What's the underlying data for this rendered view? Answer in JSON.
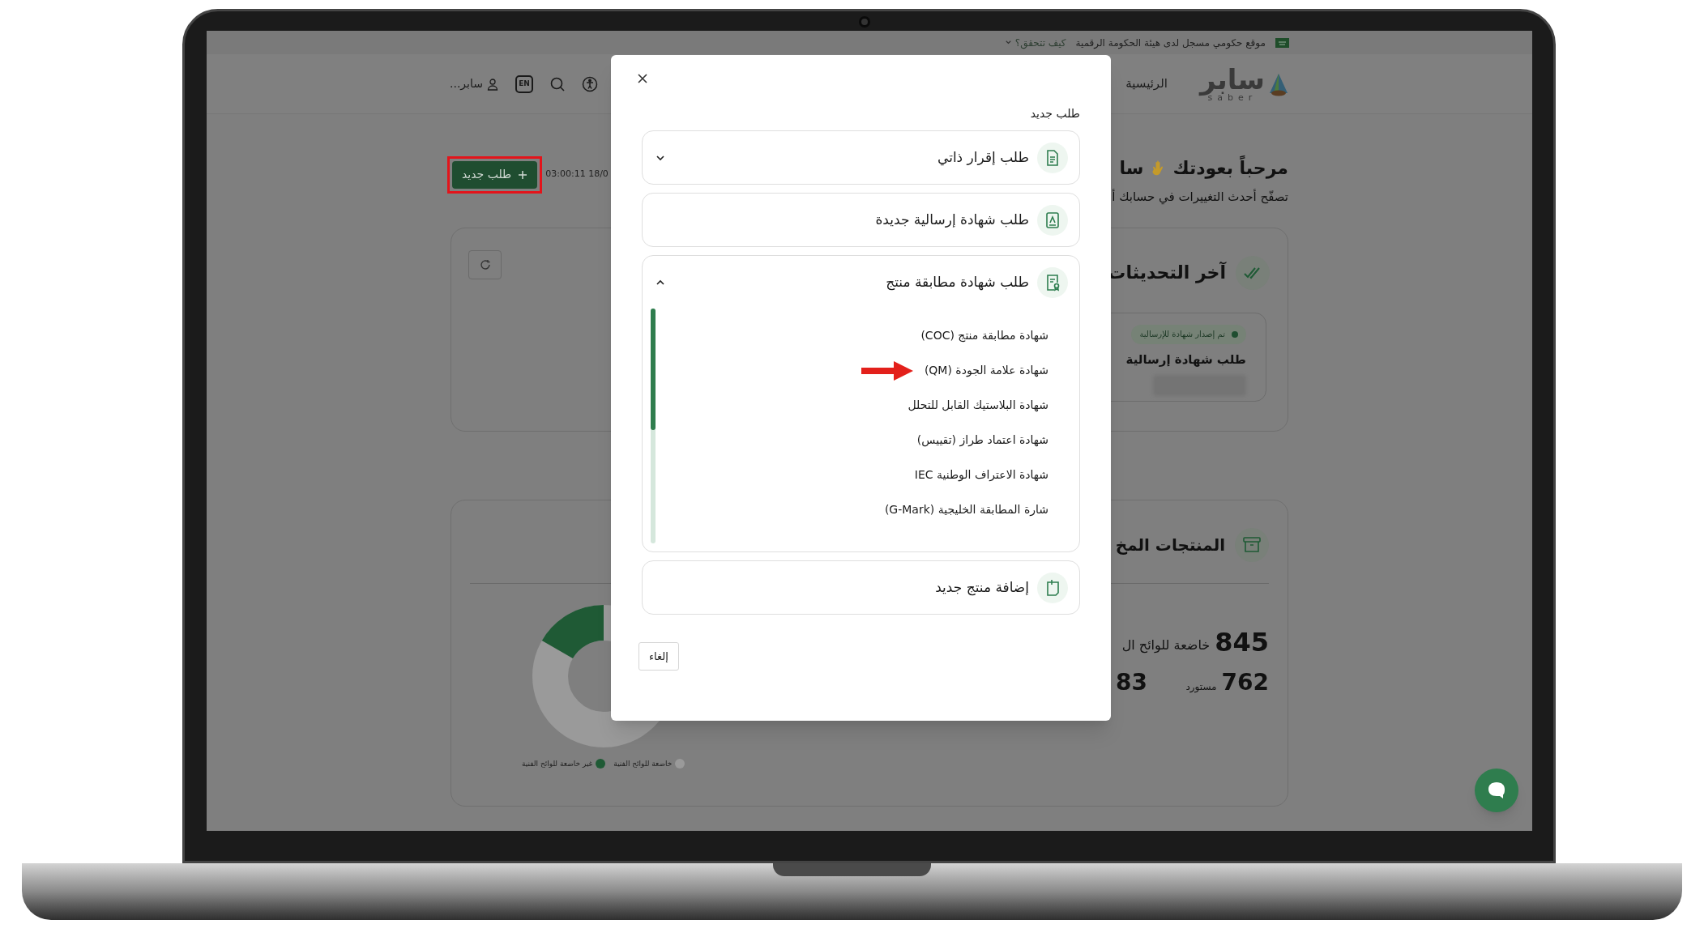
{
  "gov_bar": {
    "text": "موقع حكومي مسجل لدى هيئة الحكومة الرقمية",
    "link": "كيف تتحقق؟"
  },
  "header": {
    "logo": {
      "text": "سابر",
      "subtext": "saber"
    },
    "nav": [
      {
        "label": "الرئيسية"
      }
    ],
    "user": "سابر...",
    "language": "EN"
  },
  "welcome": {
    "title": "مرحباً بعودتك",
    "title_end": "سا",
    "subtitle": "تصفّح أحدث التغييرات في حسابك أ"
  },
  "toolbar": {
    "timestamp": "03:00:11 18/0",
    "new_request": {
      "label": "طلب جديد",
      "highlighted": true
    }
  },
  "updates": {
    "title": "آخر التحديثات",
    "items": [
      {
        "status": "تم إصدار شهادة للإرسالية",
        "title": "طلب شهادة إرسالية"
      }
    ]
  },
  "products": {
    "title": "المنتجات المخ",
    "total": "845",
    "total_label": "خاضعة للوائح ال",
    "stats": [
      {
        "value": "762",
        "label": "مستورد"
      },
      {
        "value": "83"
      }
    ],
    "legend": [
      {
        "label": "خاضعة للوائح الفنية",
        "color": "#9a9a9a"
      },
      {
        "label": "غير خاضعة للوائح الفنية",
        "color": "#1f5a35"
      }
    ]
  },
  "modal": {
    "title": "طلب جديد",
    "options": [
      {
        "kind": "group",
        "label": "طلب إقرار ذاتي",
        "expanded": false
      },
      {
        "kind": "link",
        "label": "طلب شهادة إرسالية جديدة"
      },
      {
        "kind": "group",
        "label": "طلب شهادة مطابقة منتج",
        "expanded": true,
        "children": [
          {
            "label": "شهادة مطابقة منتج (COC)",
            "marked": false
          },
          {
            "label": "شهادة علامة الجودة (QM)",
            "marked": true
          },
          {
            "label": "شهادة البلاستيك القابل للتحلل",
            "marked": false
          },
          {
            "label": "شهادة اعتماد طراز (تقييس)",
            "marked": false
          },
          {
            "label": "شهادة الاعتراف الوطنية IEC",
            "marked": false
          },
          {
            "label": "شارة المطابقة الخليجية (G-Mark)",
            "marked": false
          }
        ]
      },
      {
        "kind": "link",
        "label": "إضافة منتج جديد"
      }
    ],
    "cancel": "إلغاء"
  }
}
